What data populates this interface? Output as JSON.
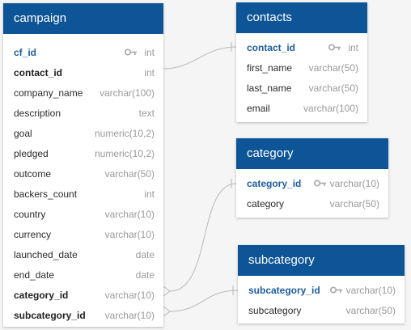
{
  "colors": {
    "header": "#0d5596",
    "connector": "#b9b9b9"
  },
  "tables": {
    "campaign": {
      "name": "campaign",
      "fields": [
        {
          "name": "cf_id",
          "type": "int"
        },
        {
          "name": "contact_id",
          "type": "int"
        },
        {
          "name": "company_name",
          "type": "varchar(100)"
        },
        {
          "name": "description",
          "type": "text"
        },
        {
          "name": "goal",
          "type": "numeric(10,2)"
        },
        {
          "name": "pledged",
          "type": "numeric(10,2)"
        },
        {
          "name": "outcome",
          "type": "varchar(50)"
        },
        {
          "name": "backers_count",
          "type": "int"
        },
        {
          "name": "country",
          "type": "varchar(10)"
        },
        {
          "name": "currency",
          "type": "varchar(10)"
        },
        {
          "name": "launched_date",
          "type": "date"
        },
        {
          "name": "end_date",
          "type": "date"
        },
        {
          "name": "category_id",
          "type": "varchar(10)"
        },
        {
          "name": "subcategory_id",
          "type": "varchar(10)"
        }
      ]
    },
    "contacts": {
      "name": "contacts",
      "fields": [
        {
          "name": "contact_id",
          "type": "int"
        },
        {
          "name": "first_name",
          "type": "varchar(50)"
        },
        {
          "name": "last_name",
          "type": "varchar(50)"
        },
        {
          "name": "email",
          "type": "varchar(100)"
        }
      ]
    },
    "category": {
      "name": "category",
      "fields": [
        {
          "name": "category_id",
          "type": "varchar(10)"
        },
        {
          "name": "category",
          "type": "varchar(50)"
        }
      ]
    },
    "subcategory": {
      "name": "subcategory",
      "fields": [
        {
          "name": "subcategory_id",
          "type": "varchar(10)"
        },
        {
          "name": "subcategory",
          "type": "varchar(50)"
        }
      ]
    }
  }
}
